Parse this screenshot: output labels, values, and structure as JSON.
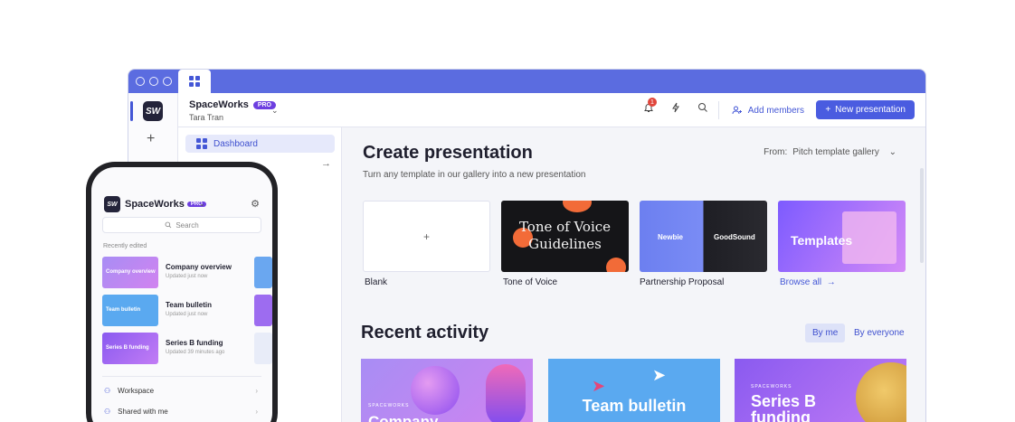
{
  "window": {
    "workspace_name": "SpaceWorks",
    "pro_badge": "PRO",
    "user_name": "Tara Tran",
    "logo_text": "SW",
    "notification_count": "1",
    "add_members": "Add members",
    "new_presentation": "New presentation"
  },
  "sidebar": {
    "dashboard": "Dashboard"
  },
  "create": {
    "title": "Create presentation",
    "subtitle": "Turn any template in our gallery into a new presentation",
    "from_label": "From:",
    "from_value": "Pitch template gallery",
    "templates": [
      {
        "label": "Blank",
        "thumb_text": "+"
      },
      {
        "label": "Tone of Voice",
        "thumb_text": "Tone of Voice Guidelines"
      },
      {
        "label": "Partnership Proposal",
        "thumb_left": "Newbie",
        "thumb_right": "GoodSound"
      },
      {
        "label": "Browse all",
        "thumb_text": "Templates"
      }
    ]
  },
  "recent": {
    "title": "Recent activity",
    "filters": [
      "By me",
      "By everyone"
    ],
    "cards": [
      {
        "kicker": "SPACEWORKS",
        "title": "Company"
      },
      {
        "title": "Team bulletin"
      },
      {
        "kicker": "SPACEWORKS",
        "title": "Series B funding"
      }
    ]
  },
  "phone": {
    "workspace_name": "SpaceWorks",
    "pro_badge": "PRO",
    "logo_text": "SW",
    "search_placeholder": "Search",
    "recent_label": "Recently edited",
    "items": [
      {
        "title": "Company overview",
        "meta": "Updated just now",
        "thumb": "Company overview"
      },
      {
        "title": "Team bulletin",
        "meta": "Updated just now",
        "thumb": "Team bulletin"
      },
      {
        "title": "Series B funding",
        "meta": "Updated 39 minutes ago",
        "thumb": "Series B funding"
      }
    ],
    "nav": [
      "Workspace",
      "Shared with me"
    ]
  },
  "colors": {
    "accent": "#4a5ce0",
    "topbar": "#5b6ce0",
    "pro": "#6d3fe0",
    "badge": "#e0453b"
  }
}
